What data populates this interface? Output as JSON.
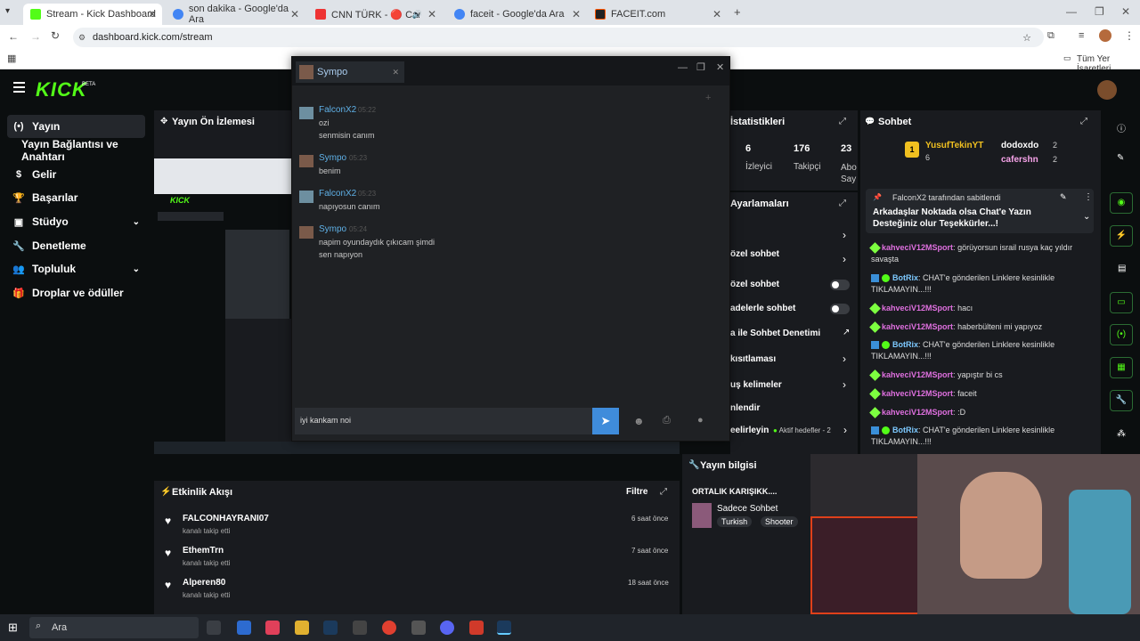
{
  "browser": {
    "tabs": [
      {
        "label": "Stream - Kick Dashboard"
      },
      {
        "label": "son dakika - Google'da Ara"
      },
      {
        "label": "CNN TÜRK - 🔴 Canlı Yayın"
      },
      {
        "label": "faceit - Google'da Ara"
      },
      {
        "label": "FACEIT.com"
      }
    ],
    "url": "dashboard.kick.com/stream",
    "bookmarks_label": "Tüm Yer İşaretleri"
  },
  "kick": {
    "logo": "KICK",
    "beta": "BETA"
  },
  "sidebar": {
    "items": [
      {
        "label": "Yayın",
        "icon": "broadcast-icon"
      },
      {
        "label": "Yayın Bağlantısı ve Anahtarı"
      },
      {
        "label": "Gelir",
        "icon": "dollar-icon"
      },
      {
        "label": "Başarılar",
        "icon": "trophy-icon"
      },
      {
        "label": "Stüdyo",
        "icon": "studio-icon"
      },
      {
        "label": "Denetleme",
        "icon": "wrench-icon"
      },
      {
        "label": "Topluluk",
        "icon": "community-icon"
      },
      {
        "label": "Droplar ve ödüller",
        "icon": "gift-icon"
      }
    ]
  },
  "preview": {
    "title": "Yayın Ön İzlemesi"
  },
  "stats": {
    "title": "İstatistikleri",
    "values": [
      {
        "value": "6",
        "label": "İzleyici"
      },
      {
        "value": "176",
        "label": "Takipçi"
      },
      {
        "value": "23",
        "label": "Abo Sayı"
      }
    ]
  },
  "settings": {
    "title": "Ayarlamaları",
    "rows": [
      {
        "label": "özel sohbet"
      },
      {
        "label": "özel sohbet"
      },
      {
        "label": "adelerle sohbet"
      },
      {
        "label": "a ile Sohbet Denetimi"
      },
      {
        "label": "kısıtlaması"
      },
      {
        "label": "uş kelimeler"
      },
      {
        "label": "nlendir"
      },
      {
        "label": "eelirleyin",
        "extra": "Aktif hedefler - 2"
      }
    ]
  },
  "activity": {
    "title": "Etkinlik Akışı",
    "filter": "Filtre",
    "items": [
      {
        "name": "FALCONHAYRANI07",
        "desc": "kanalı takip etti",
        "time": "6 saat önce"
      },
      {
        "name": "EthemTrn",
        "desc": "kanalı takip etti",
        "time": "7 saat önce"
      },
      {
        "name": "Alperen80",
        "desc": "kanalı takip etti",
        "time": "18 saat önce"
      }
    ]
  },
  "streaminfo": {
    "title": "Yayın bilgisi",
    "stream_title": "ORTALIK KARIŞIKK....",
    "category": "Sadece Sohbet",
    "tags": [
      "Turkish",
      "Shooter"
    ]
  },
  "chatwindow": {
    "tab_label": "Sympo",
    "messages": [
      {
        "name": "FalconX2",
        "time": "05:22",
        "lines": [
          "ozi",
          "senmisin canım"
        ]
      },
      {
        "name": "Sympo",
        "time": "05:23",
        "lines": [
          "benim"
        ]
      },
      {
        "name": "FalconX2",
        "time": "05:23",
        "lines": [
          "napıyosun canım"
        ]
      },
      {
        "name": "Sympo",
        "time": "05:24",
        "lines": [
          "napim oyundaydık çıkıcam şimdi",
          "sen napıyon"
        ]
      }
    ],
    "input_value": "iyi kankam noi"
  },
  "chat": {
    "title": "Sohbet",
    "leaders": [
      {
        "name": "YusufTekinYT",
        "count": "6"
      },
      {
        "name": "dodoxdo",
        "count": "2"
      },
      {
        "name": "cafershn",
        "count": "2"
      }
    ],
    "pinned_by": "FalconX2 tarafından sabitlendi",
    "pinned_text": "Arkadaşlar Noktada olsa Chat'e Yazın Desteğiniz olur Teşekkürler...!",
    "messages": [
      {
        "user": "kahveciV12MSport",
        "text": "görüyorsun israil rusya kaç yıldır savaşta"
      },
      {
        "user": "BotRix",
        "text": "CHAT'e gönderilen Linklere kesinlikle TIKLAMAYIN...!!!"
      },
      {
        "user": "kahveciV12MSport",
        "text": "hacı"
      },
      {
        "user": "kahveciV12MSport",
        "text": "haberbülteni mi yapıyoz"
      },
      {
        "user": "BotRix",
        "text": "CHAT'e gönderilen Linklere kesinlikle TIKLAMAYIN...!!!"
      },
      {
        "user": "kahveciV12MSport",
        "text": "yapıştır bi cs"
      },
      {
        "user": "kahveciV12MSport",
        "text": "faceit"
      },
      {
        "user": "kahveciV12MSport",
        "text": ":D"
      },
      {
        "user": "BotRix",
        "text": "CHAT'e gönderilen Linklere kesinlikle TIKLAMAYIN...!!!"
      }
    ]
  },
  "taskbar": {
    "search_placeholder": "Ara"
  }
}
